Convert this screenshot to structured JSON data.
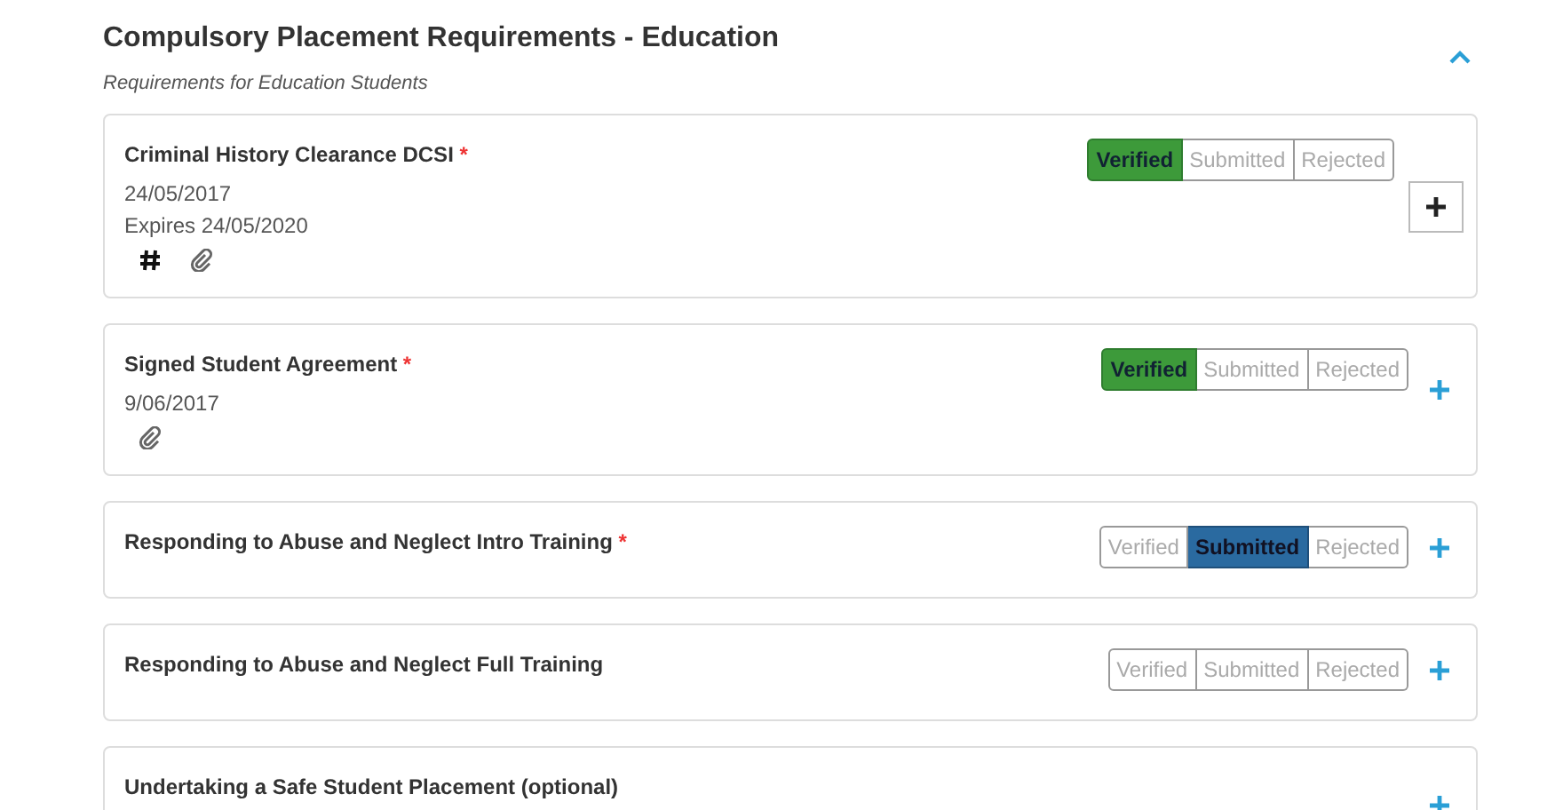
{
  "section": {
    "title": "Compulsory Placement Requirements - Education",
    "subtitle": "Requirements for Education Students",
    "expanded": true
  },
  "requirements": [
    {
      "title": "Criminal History Clearance DCSI",
      "required_mark": "*",
      "details": [
        "24/05/2017",
        "Expires 24/05/2020"
      ],
      "icons": [
        {
          "kind": "hash"
        },
        {
          "kind": "paperclip"
        }
      ],
      "statuses": [
        {
          "label": "Verified",
          "kind": "verified",
          "selected": true
        },
        {
          "label": "Submitted",
          "kind": "submitted",
          "selected": false
        },
        {
          "label": "Rejected",
          "kind": "rejected",
          "selected": false
        }
      ],
      "add_focused": true
    },
    {
      "title": "Signed Student Agreement",
      "required_mark": "*",
      "details": [
        "9/06/2017"
      ],
      "icons": [
        {
          "kind": "paperclip"
        }
      ],
      "statuses": [
        {
          "label": "Verified",
          "kind": "verified",
          "selected": true
        },
        {
          "label": "Submitted",
          "kind": "submitted",
          "selected": false
        },
        {
          "label": "Rejected",
          "kind": "rejected",
          "selected": false
        }
      ],
      "add_focused": false
    },
    {
      "title": "Responding to Abuse and Neglect Intro Training",
      "required_mark": "*",
      "statuses": [
        {
          "label": "Verified",
          "kind": "verified",
          "selected": false
        },
        {
          "label": "Submitted",
          "kind": "submitted",
          "selected": true
        },
        {
          "label": "Rejected",
          "kind": "rejected",
          "selected": false
        }
      ],
      "add_focused": false
    },
    {
      "title": "Responding to Abuse and Neglect Full Training",
      "statuses": [
        {
          "label": "Verified",
          "kind": "verified",
          "selected": false
        },
        {
          "label": "Submitted",
          "kind": "submitted",
          "selected": false
        },
        {
          "label": "Rejected",
          "kind": "rejected",
          "selected": false
        }
      ],
      "add_focused": false
    },
    {
      "title": "Undertaking a Safe Student Placement (optional)",
      "add_focused": false
    }
  ]
}
